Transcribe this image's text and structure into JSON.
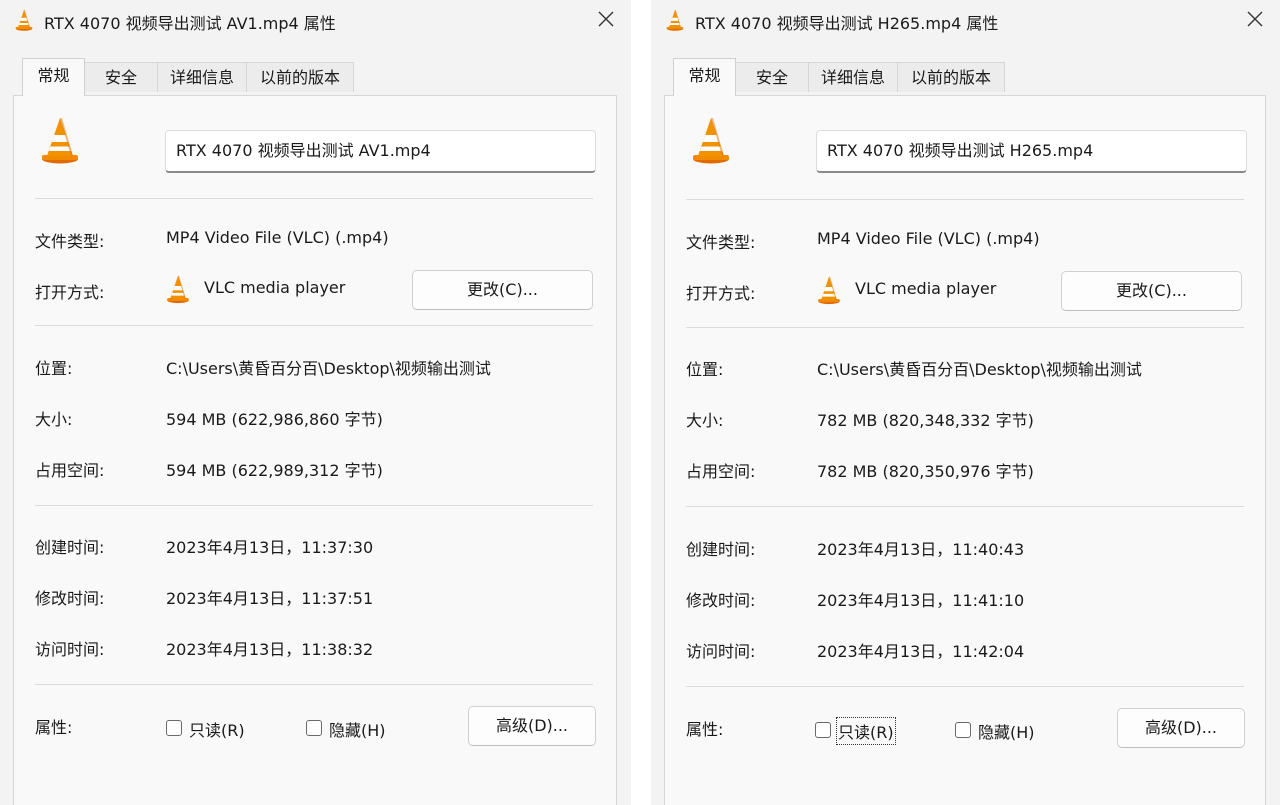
{
  "windows": [
    {
      "title": "RTX 4070 视频导出测试 AV1.mp4 属性",
      "tabs": [
        "常规",
        "安全",
        "详细信息",
        "以前的版本"
      ],
      "active_tab": "常规",
      "file_name": "RTX 4070 视频导出测试 AV1.mp4",
      "file_type_label": "文件类型:",
      "file_type": "MP4 Video File (VLC) (.mp4)",
      "opens_with_label": "打开方式:",
      "opens_with": "VLC media player",
      "change_button": "更改(C)...",
      "location_label": "位置:",
      "location": "C:\\Users\\黄昏百分百\\Desktop\\视频输出测试",
      "size_label": "大小:",
      "size": "594 MB (622,986,860 字节)",
      "size_on_disk_label": "占用空间:",
      "size_on_disk": "594 MB (622,989,312 字节)",
      "created_label": "创建时间:",
      "created": "2023年4月13日，11:37:30",
      "modified_label": "修改时间:",
      "modified": "2023年4月13日，11:37:51",
      "accessed_label": "访问时间:",
      "accessed": "2023年4月13日，11:38:32",
      "attributes_label": "属性:",
      "readonly_label": "只读(R)",
      "readonly_checked": false,
      "hidden_label": "隐藏(H)",
      "hidden_checked": false,
      "advanced_button": "高级(D)..."
    },
    {
      "title": "RTX 4070 视频导出测试 H265.mp4 属性",
      "tabs": [
        "常规",
        "安全",
        "详细信息",
        "以前的版本"
      ],
      "active_tab": "常规",
      "file_name": "RTX 4070 视频导出测试 H265.mp4",
      "file_type_label": "文件类型:",
      "file_type": "MP4 Video File (VLC) (.mp4)",
      "opens_with_label": "打开方式:",
      "opens_with": "VLC media player",
      "change_button": "更改(C)...",
      "location_label": "位置:",
      "location": "C:\\Users\\黄昏百分百\\Desktop\\视频输出测试",
      "size_label": "大小:",
      "size": "782 MB (820,348,332 字节)",
      "size_on_disk_label": "占用空间:",
      "size_on_disk": "782 MB (820,350,976 字节)",
      "created_label": "创建时间:",
      "created": "2023年4月13日，11:40:43",
      "modified_label": "修改时间:",
      "modified": "2023年4月13日，11:41:10",
      "accessed_label": "访问时间:",
      "accessed": "2023年4月13日，11:42:04",
      "attributes_label": "属性:",
      "readonly_label": "只读(R)",
      "readonly_checked": false,
      "hidden_label": "隐藏(H)",
      "hidden_checked": false,
      "advanced_button": "高级(D)..."
    }
  ],
  "icons": {
    "title_icon": "vlc-cone-icon",
    "file_icon": "vlc-cone-icon",
    "app_icon": "vlc-cone-icon",
    "close": "close-icon"
  },
  "colors": {
    "window_bg": "#f3f3f3",
    "panel_bg": "#f9f9f9",
    "vlc_orange": "#f08a00"
  }
}
